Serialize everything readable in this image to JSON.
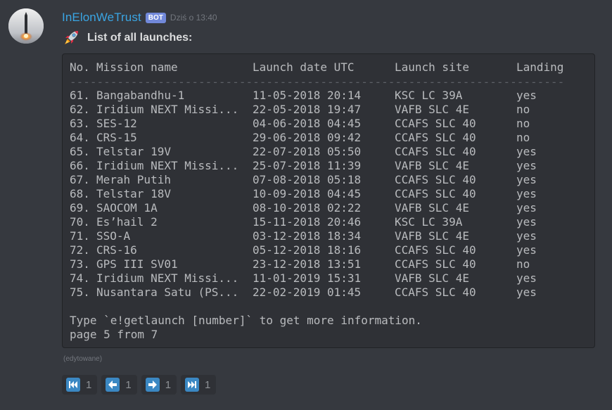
{
  "message": {
    "author": "InElonWeTrust",
    "bot_tag": "BOT",
    "timestamp": "Dziś o 13:40",
    "title_icon": "rocket-icon",
    "title": "List of all launches:",
    "edited_label": "(edytowane)"
  },
  "table": {
    "headers": {
      "no": "No.",
      "name": "Mission name",
      "date": "Launch date UTC",
      "site": "Launch site",
      "landing": "Landing"
    },
    "separator": "--------------------------------------------------------------------------------",
    "rows": [
      {
        "no": "61.",
        "name": "Bangabandhu-1",
        "date": "11-05-2018 20:14",
        "site": "KSC LC 39A",
        "landing": "yes"
      },
      {
        "no": "62.",
        "name": "Iridium NEXT Missi...",
        "date": "22-05-2018 19:47",
        "site": "VAFB SLC 4E",
        "landing": "no"
      },
      {
        "no": "63.",
        "name": "SES-12",
        "date": "04-06-2018 04:45",
        "site": "CCAFS SLC 40",
        "landing": "no"
      },
      {
        "no": "64.",
        "name": "CRS-15",
        "date": "29-06-2018 09:42",
        "site": "CCAFS SLC 40",
        "landing": "no"
      },
      {
        "no": "65.",
        "name": "Telstar 19V",
        "date": "22-07-2018 05:50",
        "site": "CCAFS SLC 40",
        "landing": "yes"
      },
      {
        "no": "66.",
        "name": "Iridium NEXT Missi...",
        "date": "25-07-2018 11:39",
        "site": "VAFB SLC 4E",
        "landing": "yes"
      },
      {
        "no": "67.",
        "name": "Merah Putih",
        "date": "07-08-2018 05:18",
        "site": "CCAFS SLC 40",
        "landing": "yes"
      },
      {
        "no": "68.",
        "name": "Telstar 18V",
        "date": "10-09-2018 04:45",
        "site": "CCAFS SLC 40",
        "landing": "yes"
      },
      {
        "no": "69.",
        "name": "SAOCOM 1A",
        "date": "08-10-2018 02:22",
        "site": "VAFB SLC 4E",
        "landing": "yes"
      },
      {
        "no": "70.",
        "name": "Es’hail 2",
        "date": "15-11-2018 20:46",
        "site": "KSC LC 39A",
        "landing": "yes"
      },
      {
        "no": "71.",
        "name": "SSO-A",
        "date": "03-12-2018 18:34",
        "site": "VAFB SLC 4E",
        "landing": "yes"
      },
      {
        "no": "72.",
        "name": "CRS-16",
        "date": "05-12-2018 18:16",
        "site": "CCAFS SLC 40",
        "landing": "yes"
      },
      {
        "no": "73.",
        "name": "GPS III SV01",
        "date": "23-12-2018 13:51",
        "site": "CCAFS SLC 40",
        "landing": "no"
      },
      {
        "no": "74.",
        "name": "Iridium NEXT Missi...",
        "date": "11-01-2019 15:31",
        "site": "VAFB SLC 4E",
        "landing": "yes"
      },
      {
        "no": "75.",
        "name": "Nusantara Satu (PS...",
        "date": "22-02-2019 01:45",
        "site": "CCAFS SLC 40",
        "landing": "yes"
      }
    ],
    "footer_hint": "Type `e!getlaunch [number]` to get more information.",
    "footer_page": "page 5 from 7"
  },
  "reactions": [
    {
      "icon": "first-page-icon",
      "count": "1"
    },
    {
      "icon": "previous-page-icon",
      "count": "1"
    },
    {
      "icon": "next-page-icon",
      "count": "1"
    },
    {
      "icon": "last-page-icon",
      "count": "1"
    }
  ],
  "colors": {
    "background": "#36393f",
    "codeblock": "#2f3136",
    "username": "#3aa5e3",
    "bot_tag": "#7289da",
    "reaction_icon": "#3b88c3"
  }
}
